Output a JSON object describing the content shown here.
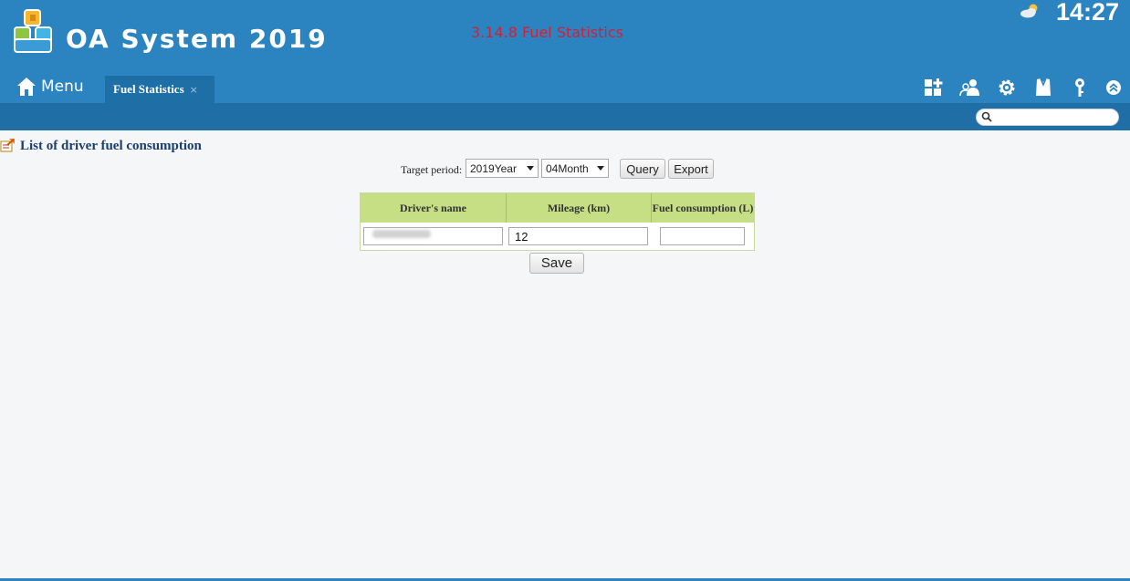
{
  "header": {
    "app_title": "OA System 2019",
    "caption": "3.14.8 Fuel Statistics",
    "clock": "14:27",
    "weather_icon": "partly-cloudy-icon",
    "menu_label": "Menu",
    "tab": {
      "label": "Fuel Statistics",
      "close": "×"
    },
    "toolbar_icons": [
      "add-widget-icon",
      "user-group-icon",
      "gear-icon",
      "shirt-icon",
      "key-icon",
      "collapse-up-icon"
    ]
  },
  "search": {
    "placeholder": "",
    "value": ""
  },
  "section": {
    "title": "List of driver fuel consumption"
  },
  "filters": {
    "label": "Target period:",
    "year": "2019Year",
    "month": "04Month",
    "query_label": "Query",
    "export_label": "Export"
  },
  "table": {
    "headers": [
      "Driver's name",
      "Mileage (km)",
      "Fuel consumption (L)"
    ],
    "rows": [
      {
        "driver": "",
        "mileage": "12",
        "fuel": ""
      }
    ]
  },
  "save_label": "Save",
  "colors": {
    "header_bg": "#2b83c0",
    "subbar_bg": "#1f6ea6",
    "caption": "#d0213a",
    "table_header": "#c6df85",
    "title": "#1a3e6e"
  }
}
